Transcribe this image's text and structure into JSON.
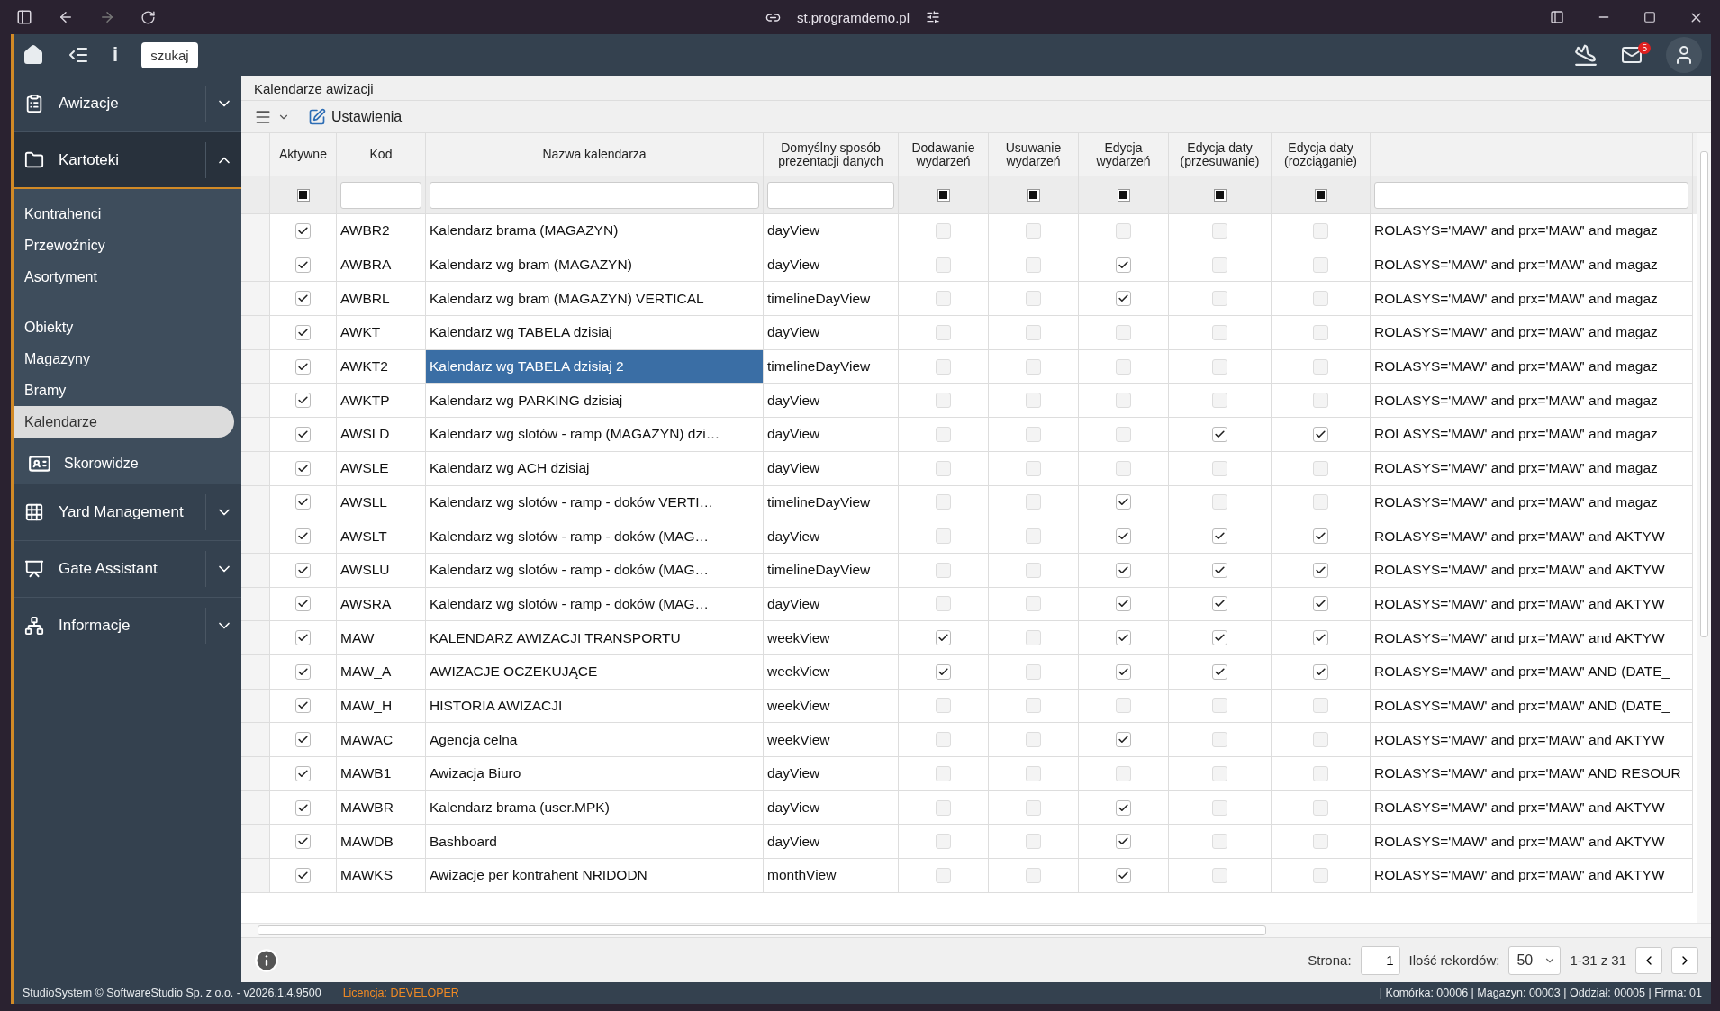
{
  "browser": {
    "address": "st.programdemo.pl"
  },
  "topbar": {
    "search_button": "szukaj",
    "info": "i",
    "mail_badge": "5"
  },
  "sidebar": {
    "groups": [
      {
        "label": "Awizacje",
        "expanded": false
      },
      {
        "label": "Kartoteki",
        "expanded": true,
        "sections": [
          {
            "items": [
              {
                "label": "Kontrahenci",
                "selected": false
              },
              {
                "label": "Przewoźnicy",
                "selected": false
              },
              {
                "label": "Asortyment",
                "selected": false
              }
            ]
          },
          {
            "items": [
              {
                "label": "Obiekty",
                "selected": false
              },
              {
                "label": "Magazyny",
                "selected": false
              },
              {
                "label": "Bramy",
                "selected": false
              },
              {
                "label": "Kalendarze",
                "selected": true
              }
            ]
          }
        ],
        "sub_item": {
          "label": "Skorowidze"
        }
      },
      {
        "label": "Yard Management",
        "expanded": false
      },
      {
        "label": "Gate Assistant",
        "expanded": false
      },
      {
        "label": "Informacje",
        "expanded": false
      }
    ]
  },
  "page": {
    "title": "Kalendarze awizacji",
    "toolbar": {
      "settings": "Ustawienia"
    }
  },
  "table": {
    "columns": [
      {
        "label": "Aktywne",
        "kind": "check",
        "filter_indeterminate": true
      },
      {
        "label": "Kod",
        "kind": "text"
      },
      {
        "label": "Nazwa kalendarza",
        "kind": "text"
      },
      {
        "label": "Domyślny sposób prezentacji danych",
        "kind": "text"
      },
      {
        "label": "Dodawanie wydarzeń",
        "kind": "check",
        "filter_indeterminate": true
      },
      {
        "label": "Usuwanie wydarzeń",
        "kind": "check",
        "filter_indeterminate": true
      },
      {
        "label": "Edycja wydarzeń",
        "kind": "check",
        "filter_indeterminate": true
      },
      {
        "label": "Edycja daty (przesuwanie)",
        "kind": "check",
        "filter_indeterminate": true
      },
      {
        "label": "Edycja daty (rozciąganie)",
        "kind": "check",
        "filter_indeterminate": true
      },
      {
        "kind": "text"
      }
    ],
    "rows": [
      {
        "active": true,
        "code": "AWBR2",
        "name": "Kalendarz brama (MAGAZYN)",
        "view": "dayView",
        "flags": [
          false,
          false,
          false,
          false,
          false
        ],
        "condition": "ROLASYS='MAW' and prx='MAW' and magaz",
        "selected": false
      },
      {
        "active": true,
        "code": "AWBRA",
        "name": "Kalendarz wg bram (MAGAZYN)",
        "view": "dayView",
        "flags": [
          false,
          false,
          true,
          false,
          false
        ],
        "condition": "ROLASYS='MAW' and prx='MAW' and magaz",
        "selected": false
      },
      {
        "active": true,
        "code": "AWBRL",
        "name": "Kalendarz wg bram (MAGAZYN) VERTICAL",
        "view": "timelineDayView",
        "flags": [
          false,
          false,
          true,
          false,
          false
        ],
        "condition": "ROLASYS='MAW' and prx='MAW' and magaz",
        "selected": false
      },
      {
        "active": true,
        "code": "AWKT",
        "name": "Kalendarz wg TABELA dzisiaj",
        "view": "dayView",
        "flags": [
          false,
          false,
          false,
          false,
          false
        ],
        "condition": "ROLASYS='MAW' and prx='MAW' and magaz",
        "selected": false
      },
      {
        "active": true,
        "code": "AWKT2",
        "name": "Kalendarz wg TABELA dzisiaj 2",
        "view": "timelineDayView",
        "flags": [
          false,
          false,
          false,
          false,
          false
        ],
        "condition": "ROLASYS='MAW' and prx='MAW' and magaz",
        "selected": true
      },
      {
        "active": true,
        "code": "AWKTP",
        "name": "Kalendarz wg PARKING dzisiaj",
        "view": "dayView",
        "flags": [
          false,
          false,
          false,
          false,
          false
        ],
        "condition": "ROLASYS='MAW' and prx='MAW' and magaz",
        "selected": false
      },
      {
        "active": true,
        "code": "AWSLD",
        "name": "Kalendarz wg slotów - ramp (MAGAZYN) dzi…",
        "view": "dayView",
        "flags": [
          false,
          false,
          false,
          true,
          true
        ],
        "condition": "ROLASYS='MAW' and prx='MAW' and magaz",
        "selected": false
      },
      {
        "active": true,
        "code": "AWSLE",
        "name": "Kalendarz wg ACH dzisiaj",
        "view": "dayView",
        "flags": [
          false,
          false,
          false,
          false,
          false
        ],
        "condition": "ROLASYS='MAW' and prx='MAW' and magaz",
        "selected": false
      },
      {
        "active": true,
        "code": "AWSLL",
        "name": "Kalendarz wg slotów - ramp - doków VERTI…",
        "view": "timelineDayView",
        "flags": [
          false,
          false,
          true,
          false,
          false
        ],
        "condition": "ROLASYS='MAW' and prx='MAW' and magaz",
        "selected": false
      },
      {
        "active": true,
        "code": "AWSLT",
        "name": "Kalendarz wg slotów - ramp - doków (MAG…",
        "view": "dayView",
        "flags": [
          false,
          false,
          true,
          true,
          true
        ],
        "condition": "ROLASYS='MAW' and prx='MAW' and AKTYW",
        "selected": false
      },
      {
        "active": true,
        "code": "AWSLU",
        "name": "Kalendarz wg slotów - ramp - doków (MAG…",
        "view": "timelineDayView",
        "flags": [
          false,
          false,
          true,
          true,
          true
        ],
        "condition": "ROLASYS='MAW' and prx='MAW' and AKTYW",
        "selected": false
      },
      {
        "active": true,
        "code": "AWSRA",
        "name": "Kalendarz wg slotów - ramp - doków (MAG…",
        "view": "dayView",
        "flags": [
          false,
          false,
          true,
          true,
          true
        ],
        "condition": "ROLASYS='MAW' and prx='MAW' and AKTYW",
        "selected": false
      },
      {
        "active": true,
        "code": "MAW",
        "name": "KALENDARZ AWIZACJI TRANSPORTU",
        "view": "weekView",
        "flags": [
          true,
          false,
          true,
          true,
          true
        ],
        "condition": "ROLASYS='MAW' and prx='MAW' and AKTYW",
        "selected": false
      },
      {
        "active": true,
        "code": "MAW_A",
        "name": "AWIZACJE OCZEKUJĄCE",
        "view": "weekView",
        "flags": [
          true,
          false,
          true,
          true,
          true
        ],
        "condition": "ROLASYS='MAW' and prx='MAW' AND (DATE_",
        "selected": false
      },
      {
        "active": true,
        "code": "MAW_H",
        "name": "HISTORIA AWIZACJI",
        "view": "weekView",
        "flags": [
          false,
          false,
          false,
          false,
          false
        ],
        "condition": "ROLASYS='MAW' and prx='MAW' AND (DATE_",
        "selected": false
      },
      {
        "active": true,
        "code": "MAWAC",
        "name": "Agencja celna",
        "view": "weekView",
        "flags": [
          false,
          false,
          true,
          false,
          false
        ],
        "condition": "ROLASYS='MAW' and prx='MAW' and AKTYW",
        "selected": false
      },
      {
        "active": true,
        "code": "MAWB1",
        "name": "Awizacja Biuro",
        "view": "dayView",
        "flags": [
          false,
          false,
          false,
          false,
          false
        ],
        "condition": "ROLASYS='MAW' and prx='MAW' AND RESOUR",
        "selected": false
      },
      {
        "active": true,
        "code": "MAWBR",
        "name": "Kalendarz brama (user.MPK)",
        "view": "dayView",
        "flags": [
          false,
          false,
          true,
          false,
          false
        ],
        "condition": "ROLASYS='MAW' and prx='MAW' and AKTYW",
        "selected": false
      },
      {
        "active": true,
        "code": "MAWDB",
        "name": "Bashboard",
        "view": "dayView",
        "flags": [
          false,
          false,
          true,
          false,
          false
        ],
        "condition": "ROLASYS='MAW' and prx='MAW' and AKTYW",
        "selected": false
      },
      {
        "active": true,
        "code": "MAWKS",
        "name": "Awizacje per kontrahent NRIDODN",
        "view": "monthView",
        "flags": [
          false,
          false,
          true,
          false,
          false
        ],
        "condition": "ROLASYS='MAW' and prx='MAW' and AKTYW",
        "selected": false
      }
    ]
  },
  "pager": {
    "page_label": "Strona:",
    "page": "1",
    "size_label": "Ilość rekordów:",
    "size": "50",
    "range": "1-31 z 31"
  },
  "status_bar": {
    "copyright": "StudioSystem © SoftwareStudio Sp. z o.o. - v2026.1.4.9500",
    "license": "Licencja: DEVELOPER",
    "context": "| Komórka: 00006 | Magazyn: 00003 | Oddział: 00005 | Firma: 01"
  }
}
